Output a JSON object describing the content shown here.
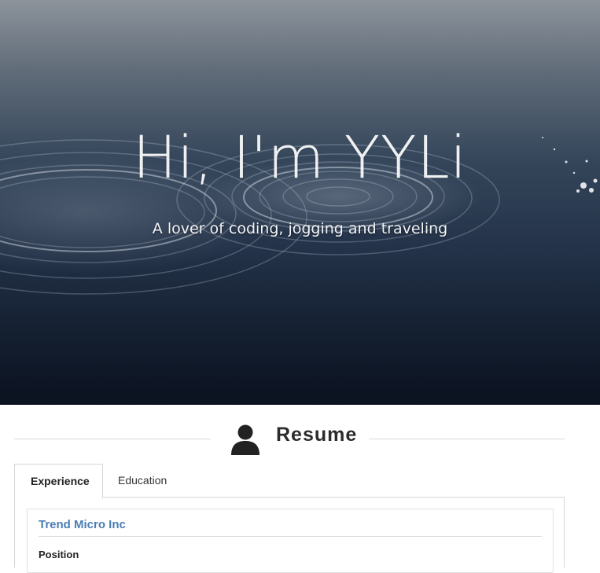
{
  "hero": {
    "title": "Hi, I'm YYLi",
    "subtitle": "A lover of coding, jogging and traveling"
  },
  "resume": {
    "heading": "Resume",
    "icon": "user-icon",
    "tabs": [
      {
        "label": "Experience",
        "active": true
      },
      {
        "label": "Education",
        "active": false
      }
    ],
    "experience": [
      {
        "company": "Trend Micro Inc",
        "field_label": "Position"
      }
    ]
  },
  "colors": {
    "link": "#4a7db5",
    "border": "#d6d6d6"
  }
}
